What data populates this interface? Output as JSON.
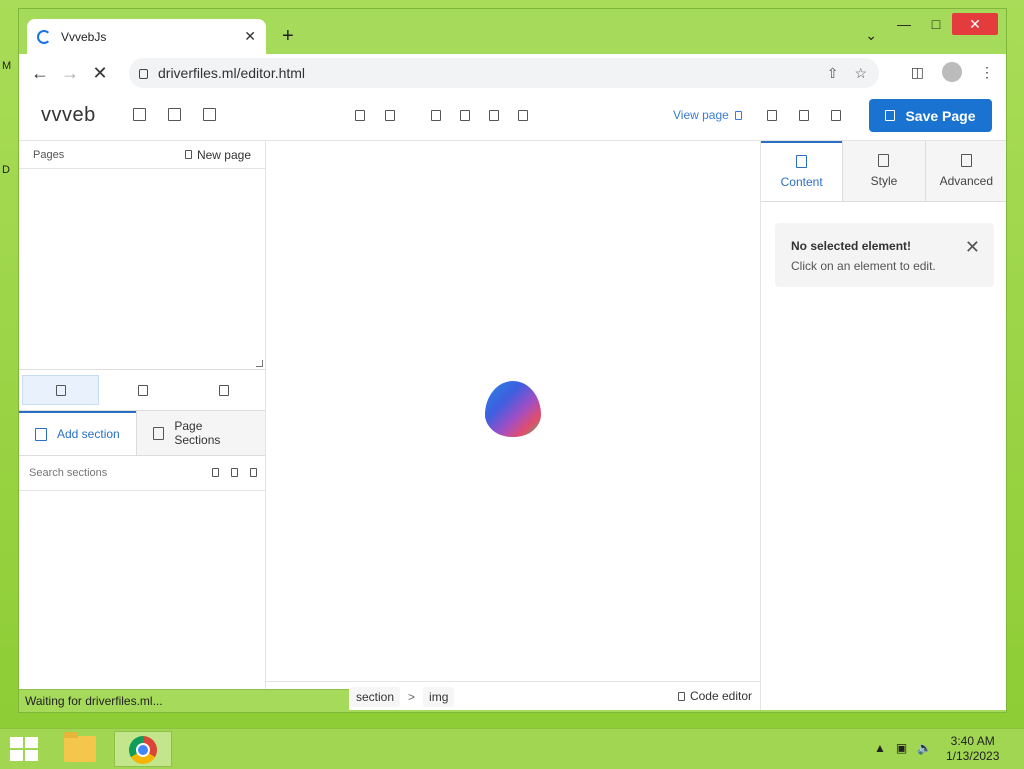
{
  "desktop": {
    "edge_text_1": "M",
    "edge_text_2": "D"
  },
  "browser": {
    "tab_title": "VvvebJs",
    "url": "driverfiles.ml/editor.html",
    "status_text": "Waiting for driverfiles.ml..."
  },
  "editor": {
    "logo_text": "vvveb",
    "view_page_label": "View page",
    "save_label": "Save Page",
    "left": {
      "pages_label": "Pages",
      "new_page_label": "New page",
      "add_section_label": "Add section",
      "page_sections_label": "Page Sections",
      "search_placeholder": "Search sections"
    },
    "bottom": {
      "crumbs": [
        "section",
        "img"
      ],
      "separator": ">",
      "code_editor_label": "Code editor"
    },
    "right": {
      "tabs": [
        "Content",
        "Style",
        "Advanced"
      ],
      "alert_title": "No selected element!",
      "alert_text": "Click on an element to edit."
    }
  },
  "taskbar": {
    "time": "3:40 AM",
    "date": "1/13/2023"
  },
  "colors": {
    "accent": "#1a73d1",
    "desktop": "#a6da5a"
  }
}
